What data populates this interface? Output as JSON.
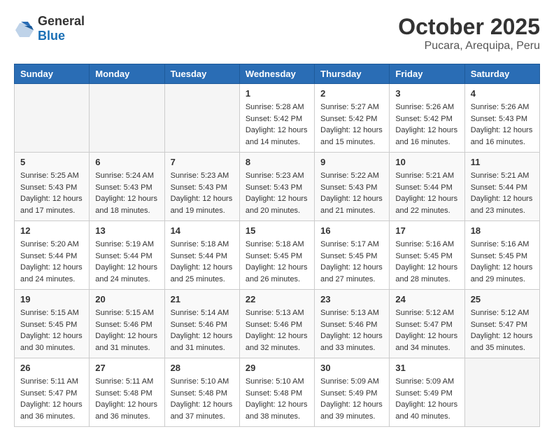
{
  "header": {
    "logo_general": "General",
    "logo_blue": "Blue",
    "month_year": "October 2025",
    "location": "Pucara, Arequipa, Peru"
  },
  "weekdays": [
    "Sunday",
    "Monday",
    "Tuesday",
    "Wednesday",
    "Thursday",
    "Friday",
    "Saturday"
  ],
  "weeks": [
    [
      {
        "day": "",
        "sunrise": "",
        "sunset": "",
        "daylight": "",
        "empty": true
      },
      {
        "day": "",
        "sunrise": "",
        "sunset": "",
        "daylight": "",
        "empty": true
      },
      {
        "day": "",
        "sunrise": "",
        "sunset": "",
        "daylight": "",
        "empty": true
      },
      {
        "day": "1",
        "sunrise": "Sunrise: 5:28 AM",
        "sunset": "Sunset: 5:42 PM",
        "daylight": "Daylight: 12 hours and 14 minutes.",
        "empty": false
      },
      {
        "day": "2",
        "sunrise": "Sunrise: 5:27 AM",
        "sunset": "Sunset: 5:42 PM",
        "daylight": "Daylight: 12 hours and 15 minutes.",
        "empty": false
      },
      {
        "day": "3",
        "sunrise": "Sunrise: 5:26 AM",
        "sunset": "Sunset: 5:42 PM",
        "daylight": "Daylight: 12 hours and 16 minutes.",
        "empty": false
      },
      {
        "day": "4",
        "sunrise": "Sunrise: 5:26 AM",
        "sunset": "Sunset: 5:43 PM",
        "daylight": "Daylight: 12 hours and 16 minutes.",
        "empty": false
      }
    ],
    [
      {
        "day": "5",
        "sunrise": "Sunrise: 5:25 AM",
        "sunset": "Sunset: 5:43 PM",
        "daylight": "Daylight: 12 hours and 17 minutes.",
        "empty": false
      },
      {
        "day": "6",
        "sunrise": "Sunrise: 5:24 AM",
        "sunset": "Sunset: 5:43 PM",
        "daylight": "Daylight: 12 hours and 18 minutes.",
        "empty": false
      },
      {
        "day": "7",
        "sunrise": "Sunrise: 5:23 AM",
        "sunset": "Sunset: 5:43 PM",
        "daylight": "Daylight: 12 hours and 19 minutes.",
        "empty": false
      },
      {
        "day": "8",
        "sunrise": "Sunrise: 5:23 AM",
        "sunset": "Sunset: 5:43 PM",
        "daylight": "Daylight: 12 hours and 20 minutes.",
        "empty": false
      },
      {
        "day": "9",
        "sunrise": "Sunrise: 5:22 AM",
        "sunset": "Sunset: 5:43 PM",
        "daylight": "Daylight: 12 hours and 21 minutes.",
        "empty": false
      },
      {
        "day": "10",
        "sunrise": "Sunrise: 5:21 AM",
        "sunset": "Sunset: 5:44 PM",
        "daylight": "Daylight: 12 hours and 22 minutes.",
        "empty": false
      },
      {
        "day": "11",
        "sunrise": "Sunrise: 5:21 AM",
        "sunset": "Sunset: 5:44 PM",
        "daylight": "Daylight: 12 hours and 23 minutes.",
        "empty": false
      }
    ],
    [
      {
        "day": "12",
        "sunrise": "Sunrise: 5:20 AM",
        "sunset": "Sunset: 5:44 PM",
        "daylight": "Daylight: 12 hours and 24 minutes.",
        "empty": false
      },
      {
        "day": "13",
        "sunrise": "Sunrise: 5:19 AM",
        "sunset": "Sunset: 5:44 PM",
        "daylight": "Daylight: 12 hours and 24 minutes.",
        "empty": false
      },
      {
        "day": "14",
        "sunrise": "Sunrise: 5:18 AM",
        "sunset": "Sunset: 5:44 PM",
        "daylight": "Daylight: 12 hours and 25 minutes.",
        "empty": false
      },
      {
        "day": "15",
        "sunrise": "Sunrise: 5:18 AM",
        "sunset": "Sunset: 5:45 PM",
        "daylight": "Daylight: 12 hours and 26 minutes.",
        "empty": false
      },
      {
        "day": "16",
        "sunrise": "Sunrise: 5:17 AM",
        "sunset": "Sunset: 5:45 PM",
        "daylight": "Daylight: 12 hours and 27 minutes.",
        "empty": false
      },
      {
        "day": "17",
        "sunrise": "Sunrise: 5:16 AM",
        "sunset": "Sunset: 5:45 PM",
        "daylight": "Daylight: 12 hours and 28 minutes.",
        "empty": false
      },
      {
        "day": "18",
        "sunrise": "Sunrise: 5:16 AM",
        "sunset": "Sunset: 5:45 PM",
        "daylight": "Daylight: 12 hours and 29 minutes.",
        "empty": false
      }
    ],
    [
      {
        "day": "19",
        "sunrise": "Sunrise: 5:15 AM",
        "sunset": "Sunset: 5:45 PM",
        "daylight": "Daylight: 12 hours and 30 minutes.",
        "empty": false
      },
      {
        "day": "20",
        "sunrise": "Sunrise: 5:15 AM",
        "sunset": "Sunset: 5:46 PM",
        "daylight": "Daylight: 12 hours and 31 minutes.",
        "empty": false
      },
      {
        "day": "21",
        "sunrise": "Sunrise: 5:14 AM",
        "sunset": "Sunset: 5:46 PM",
        "daylight": "Daylight: 12 hours and 31 minutes.",
        "empty": false
      },
      {
        "day": "22",
        "sunrise": "Sunrise: 5:13 AM",
        "sunset": "Sunset: 5:46 PM",
        "daylight": "Daylight: 12 hours and 32 minutes.",
        "empty": false
      },
      {
        "day": "23",
        "sunrise": "Sunrise: 5:13 AM",
        "sunset": "Sunset: 5:46 PM",
        "daylight": "Daylight: 12 hours and 33 minutes.",
        "empty": false
      },
      {
        "day": "24",
        "sunrise": "Sunrise: 5:12 AM",
        "sunset": "Sunset: 5:47 PM",
        "daylight": "Daylight: 12 hours and 34 minutes.",
        "empty": false
      },
      {
        "day": "25",
        "sunrise": "Sunrise: 5:12 AM",
        "sunset": "Sunset: 5:47 PM",
        "daylight": "Daylight: 12 hours and 35 minutes.",
        "empty": false
      }
    ],
    [
      {
        "day": "26",
        "sunrise": "Sunrise: 5:11 AM",
        "sunset": "Sunset: 5:47 PM",
        "daylight": "Daylight: 12 hours and 36 minutes.",
        "empty": false
      },
      {
        "day": "27",
        "sunrise": "Sunrise: 5:11 AM",
        "sunset": "Sunset: 5:48 PM",
        "daylight": "Daylight: 12 hours and 36 minutes.",
        "empty": false
      },
      {
        "day": "28",
        "sunrise": "Sunrise: 5:10 AM",
        "sunset": "Sunset: 5:48 PM",
        "daylight": "Daylight: 12 hours and 37 minutes.",
        "empty": false
      },
      {
        "day": "29",
        "sunrise": "Sunrise: 5:10 AM",
        "sunset": "Sunset: 5:48 PM",
        "daylight": "Daylight: 12 hours and 38 minutes.",
        "empty": false
      },
      {
        "day": "30",
        "sunrise": "Sunrise: 5:09 AM",
        "sunset": "Sunset: 5:49 PM",
        "daylight": "Daylight: 12 hours and 39 minutes.",
        "empty": false
      },
      {
        "day": "31",
        "sunrise": "Sunrise: 5:09 AM",
        "sunset": "Sunset: 5:49 PM",
        "daylight": "Daylight: 12 hours and 40 minutes.",
        "empty": false
      },
      {
        "day": "",
        "sunrise": "",
        "sunset": "",
        "daylight": "",
        "empty": true
      }
    ]
  ]
}
